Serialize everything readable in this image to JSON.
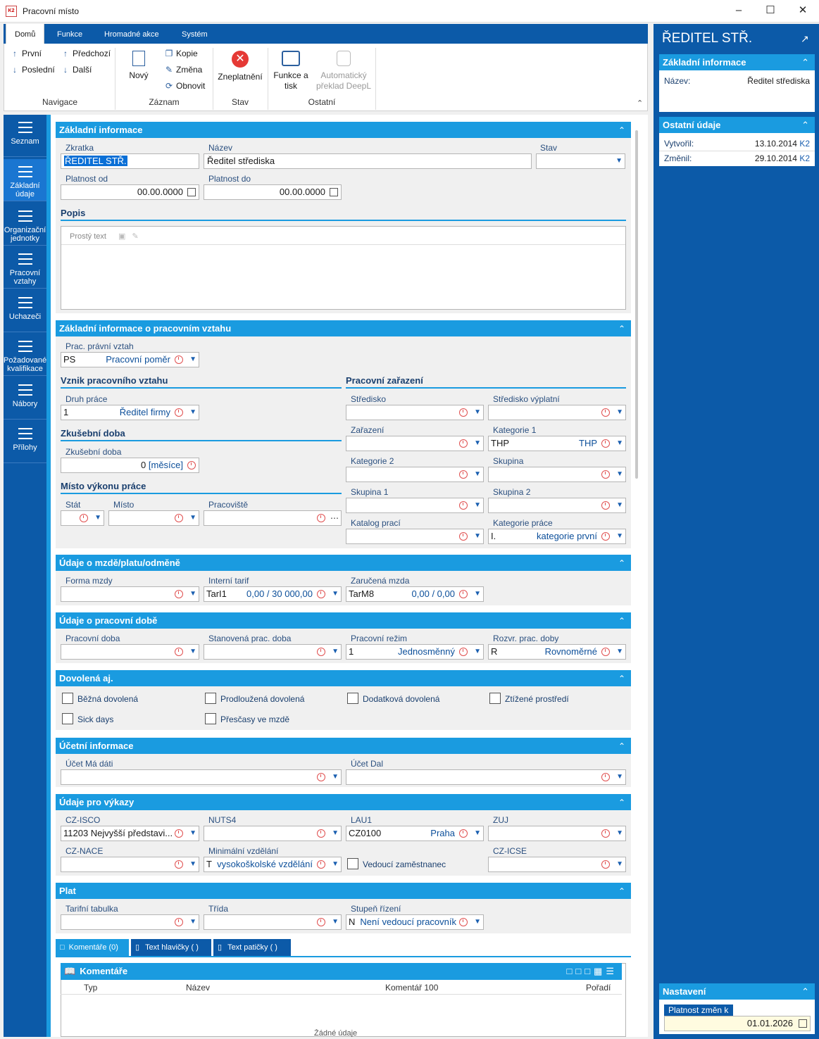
{
  "window": {
    "title": "Pracovní místo",
    "icon_text": "K2"
  },
  "ribbon": {
    "tabs": [
      "Domů",
      "Funkce",
      "Hromadné akce",
      "Systém"
    ],
    "navigace": {
      "prvni": "První",
      "predchozi": "Předchozí",
      "posledni": "Poslední",
      "dalsi": "Další",
      "label": "Navigace"
    },
    "zaznam": {
      "novy": "Nový",
      "kopie": "Kopie",
      "zmena": "Změna",
      "obnovit": "Obnovit",
      "label": "Záznam"
    },
    "stav": {
      "zneplatneni": "Zneplatnění",
      "label": "Stav"
    },
    "ostatni": {
      "funkce_tisk_1": "Funkce a",
      "funkce_tisk_2": "tisk",
      "preklad_1": "Automatický",
      "preklad_2": "překlad DeepL",
      "label": "Ostatní"
    }
  },
  "nav": [
    {
      "l1": "Seznam",
      "l2": ""
    },
    {
      "l1": "Základní",
      "l2": "údaje"
    },
    {
      "l1": "Organizační",
      "l2": "jednotky"
    },
    {
      "l1": "Pracovní",
      "l2": "vztahy"
    },
    {
      "l1": "Uchazeči",
      "l2": ""
    },
    {
      "l1": "Požadované",
      "l2": "kvalifikace"
    },
    {
      "l1": "Nábory",
      "l2": ""
    },
    {
      "l1": "Přílohy",
      "l2": ""
    }
  ],
  "zakladni": {
    "title": "Základní informace",
    "zkratka_label": "Zkratka",
    "zkratka": "ŘEDITEL STŘ.",
    "nazev_label": "Název",
    "nazev": "Ředitel střediska",
    "stav_label": "Stav",
    "platnost_od_label": "Platnost od",
    "platnost_od": "00.00.0000",
    "platnost_do_label": "Platnost do",
    "platnost_do": "00.00.0000",
    "popis_label": "Popis",
    "prosty_text": "Prostý text"
  },
  "vztah": {
    "title": "Základní informace o pracovním vztahu",
    "prac_pravni_label": "Prac. právní vztah",
    "prac_pravni_code": "PS",
    "prac_pravni_val": "Pracovní poměr",
    "vznik_title": "Vznik pracovního vztahu",
    "druh_prace_label": "Druh práce",
    "druh_prace_code": "1",
    "druh_prace_val": "Ředitel firmy",
    "zkusebni_title": "Zkušební doba",
    "zkusebni_label": "Zkušební doba",
    "zkusebni_val": "0",
    "zkusebni_unit": "[měsíce]",
    "misto_title": "Místo výkonu práce",
    "stat_label": "Stát",
    "misto_label": "Místo",
    "pracoviste_label": "Pracoviště",
    "zarazeni_title": "Pracovní zařazení",
    "stredisko_label": "Středisko",
    "stredisko_vyplatni_label": "Středisko výplatní",
    "zarazeni_label": "Zařazení",
    "kategorie1_label": "Kategorie 1",
    "kategorie1_code": "THP",
    "kategorie1_val": "THP",
    "kategorie2_label": "Kategorie 2",
    "skupina_label": "Skupina",
    "skupina1_label": "Skupina 1",
    "skupina2_label": "Skupina 2",
    "katalog_label": "Katalog prací",
    "kategorie_prace_label": "Kategorie práce",
    "kategorie_prace_code": "I.",
    "kategorie_prace_val": "kategorie první"
  },
  "mzda": {
    "title": "Údaje o mzdě/platu/odměně",
    "forma_label": "Forma mzdy",
    "tarif_label": "Interní tarif",
    "tarif_code": "TarI1",
    "tarif_val": "0,00 / 30 000,00",
    "zarucena_label": "Zaručená mzda",
    "zarucena_code": "TarM8",
    "zarucena_val": "0,00 / 0,00"
  },
  "doba": {
    "title": "Údaje o pracovní době",
    "prac_doba_label": "Pracovní doba",
    "stanovena_label": "Stanovená prac. doba",
    "rezim_label": "Pracovní režim",
    "rezim_code": "1",
    "rezim_val": "Jednosměnný",
    "rozvrh_label": "Rozvr. prac. doby",
    "rozvrh_code": "R",
    "rozvrh_val": "Rovnoměrné"
  },
  "dovolena": {
    "title": "Dovolená aj.",
    "items": [
      "Běžná dovolená",
      "Prodloužená dovolená",
      "Dodatková dovolená",
      "Ztížené prostředí",
      "Sick days",
      "Přesčasy ve mzdě"
    ]
  },
  "ucetni": {
    "title": "Účetní informace",
    "ma_dati_label": "Účet Má dáti",
    "dal_label": "Účet Dal"
  },
  "vykazy": {
    "title": "Údaje pro výkazy",
    "isco_label": "CZ-ISCO",
    "isco_val": "11203 Nejvyšší představi...",
    "nuts_label": "NUTS4",
    "lau_label": "LAU1",
    "lau_code": "CZ0100",
    "lau_val": "Praha",
    "zuj_label": "ZUJ",
    "nace_label": "CZ-NACE",
    "vzdelani_label": "Minimální vzdělání",
    "vzdelani_code": "T",
    "vzdelani_val": "vysokoškolské vzdělání",
    "vedouci_label": "Vedoucí zaměstnanec",
    "icse_label": "CZ-ICSE"
  },
  "plat": {
    "title": "Plat",
    "tabulka_label": "Tarifní tabulka",
    "trida_label": "Třída",
    "stupen_label": "Stupeň řízení",
    "stupen_code": "N",
    "stupen_val": "Není vedoucí pracovník"
  },
  "bottom_tabs": [
    "Komentáře (0)",
    "Text hlavičky ( )",
    "Text patičky ( )"
  ],
  "komentare": {
    "title": "Komentáře",
    "cols": [
      "Typ",
      "Název",
      "Komentář 100",
      "Pořadí"
    ],
    "empty": "Žádné údaje"
  },
  "right": {
    "header": "ŘEDITEL STŘ.",
    "zakladni_title": "Základní informace",
    "nazev_label": "Název:",
    "nazev": "Ředitel střediska",
    "ostatni_title": "Ostatní údaje",
    "vytvoril_label": "Vytvořil:",
    "vytvoril_date": "13.10.2014",
    "vytvoril_user": "K2",
    "zmenil_label": "Změnil:",
    "zmenil_date": "29.10.2014",
    "zmenil_user": "K2",
    "nastaveni_title": "Nastavení",
    "platnost_label": "Platnost změn k",
    "platnost_val": "01.01.2026"
  }
}
